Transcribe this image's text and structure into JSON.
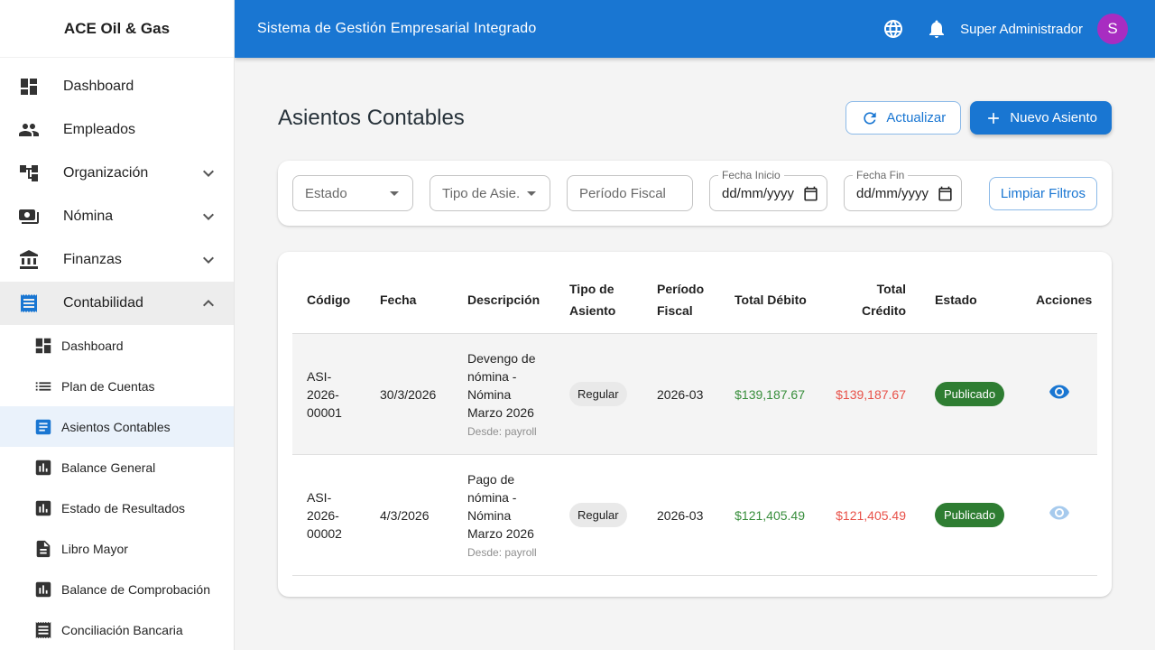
{
  "brand": "ACE Oil & Gas",
  "topbar": {
    "title": "Sistema de Gestión Empresarial Integrado",
    "user": "Super Administrador",
    "avatar_initial": "S"
  },
  "sidebar": {
    "items": [
      {
        "label": "Dashboard",
        "icon": "dashboard"
      },
      {
        "label": "Empleados",
        "icon": "people"
      },
      {
        "label": "Organización",
        "icon": "org-tree",
        "chevron": "down"
      },
      {
        "label": "Nómina",
        "icon": "payments",
        "chevron": "down"
      },
      {
        "label": "Finanzas",
        "icon": "bank",
        "chevron": "down"
      },
      {
        "label": "Contabilidad",
        "icon": "receipt",
        "chevron": "up",
        "active": true
      }
    ],
    "submenu": [
      {
        "label": "Dashboard",
        "icon": "dashboard"
      },
      {
        "label": "Plan de Cuentas",
        "icon": "list"
      },
      {
        "label": "Asientos Contables",
        "icon": "article",
        "selected": true
      },
      {
        "label": "Balance General",
        "icon": "bar-chart"
      },
      {
        "label": "Estado de Resultados",
        "icon": "bar-chart"
      },
      {
        "label": "Libro Mayor",
        "icon": "document"
      },
      {
        "label": "Balance de Comprobación",
        "icon": "bar-chart"
      },
      {
        "label": "Conciliación Bancaria",
        "icon": "receipt"
      }
    ]
  },
  "page": {
    "title": "Asientos Contables",
    "refresh_label": "Actualizar",
    "new_label": "Nuevo Asiento"
  },
  "filters": {
    "estado_label": "Estado",
    "tipo_label": "Tipo de Asie...",
    "periodo_placeholder": "Período Fiscal",
    "fecha_inicio_label": "Fecha Inicio",
    "fecha_fin_label": "Fecha Fin",
    "date_placeholder": "dd/mm/yyyy",
    "clear_label": "Limpiar Filtros"
  },
  "table": {
    "headers": [
      "Código",
      "Fecha",
      "Descripción",
      "Tipo de Asiento",
      "Período Fiscal",
      "Total Débito",
      "Total Crédito",
      "Estado",
      "Acciones"
    ],
    "rows": [
      {
        "codigo": "ASI-2026-00001",
        "fecha": "30/3/2026",
        "descripcion": "Devengo de nómina - Nómina Marzo 2026",
        "desde": "Desde: payroll",
        "tipo": "Regular",
        "periodo": "2026-03",
        "debito": "$139,187.67",
        "credito": "$139,187.67",
        "estado": "Publicado"
      },
      {
        "codigo": "ASI-2026-00002",
        "fecha": "4/3/2026",
        "descripcion": "Pago de nómina - Nómina Marzo 2026",
        "desde": "Desde: payroll",
        "tipo": "Regular",
        "periodo": "2026-03",
        "debito": "$121,405.49",
        "credito": "$121,405.49",
        "estado": "Publicado"
      }
    ]
  },
  "colors": {
    "primary": "#1976d2",
    "avatar": "#a82dc1",
    "debit": "#388e3c",
    "credit": "#e85149",
    "published": "#2e7d32",
    "selected_bg": "#eaf2fb",
    "active_bg": "#ededed",
    "row_hover": "#f4f4f4"
  }
}
